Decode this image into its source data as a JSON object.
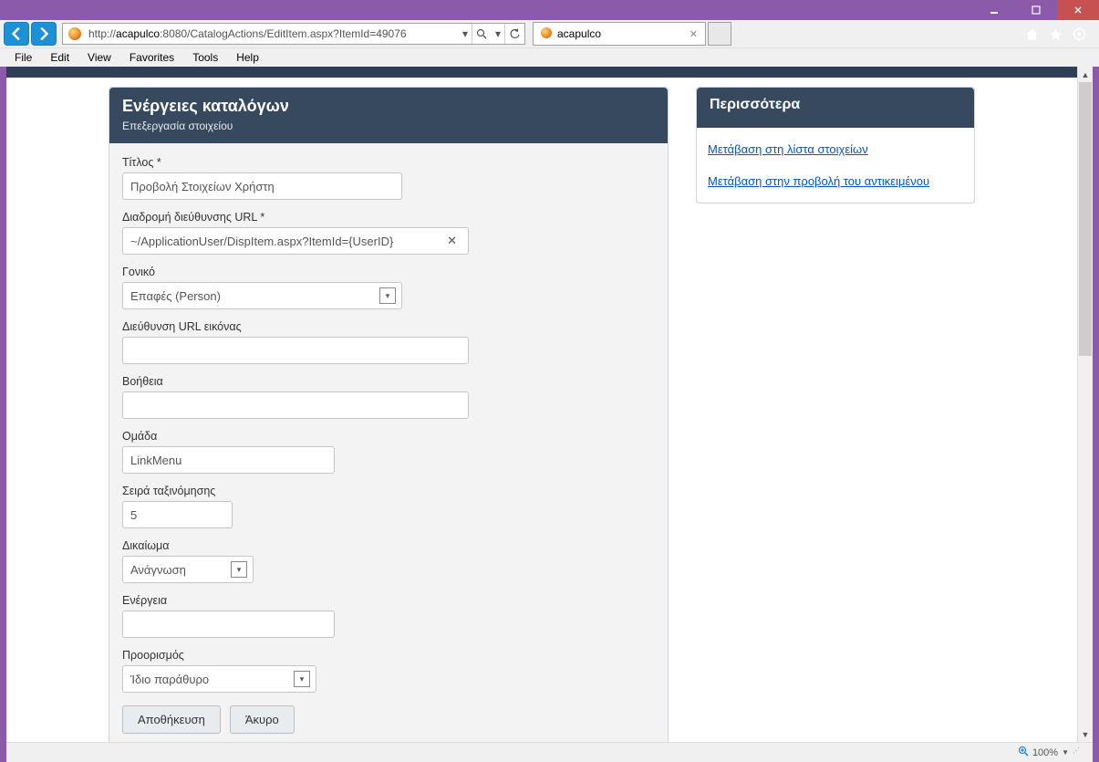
{
  "browser": {
    "url_plain": "http://acapulco:8080/CatalogActions/EditItem.aspx?ItemId=49076",
    "url_host": "acapulco",
    "url_pre": "http://",
    "url_post": ":8080/CatalogActions/EditItem.aspx?ItemId=49076",
    "tab_title": "acapulco",
    "menus": {
      "file": "File",
      "edit": "Edit",
      "view": "View",
      "favorites": "Favorites",
      "tools": "Tools",
      "help": "Help"
    },
    "zoom": "100%"
  },
  "page": {
    "panel_title": "Ενέργειες καταλόγων",
    "panel_subtitle": "Επεξεργασία στοιχείου",
    "labels": {
      "title": "Τίτλος *",
      "urlpath": "Διαδρομή διεύθυνσης URL *",
      "parent": "Γονικό",
      "imgurl": "Διεύθυνση URL εικόνας",
      "help": "Βοήθεια",
      "group": "Ομάδα",
      "sort": "Σειρά ταξινόμησης",
      "perm": "Δικαίωμα",
      "action": "Ενέργεια",
      "target": "Προορισμός"
    },
    "values": {
      "title": "Προβολή Στοιχείων Χρήστη",
      "urlpath": "~/ApplicationUser/DispItem.aspx?ItemId={UserID}",
      "parent": "Επαφές (Person)",
      "imgurl": "",
      "help": "",
      "group": "LinkMenu",
      "sort": "5",
      "perm": "Ανάγνωση",
      "action": "",
      "target": "Ίδιο παράθυρο"
    },
    "buttons": {
      "save": "Αποθήκευση",
      "cancel": "Άκυρο"
    },
    "side_title": "Περισσότερα",
    "side_links": {
      "list": "Μετάβαση στη λίστα στοιχείων",
      "view": "Μετάβαση στην προβολή του αντικειμένου"
    }
  }
}
